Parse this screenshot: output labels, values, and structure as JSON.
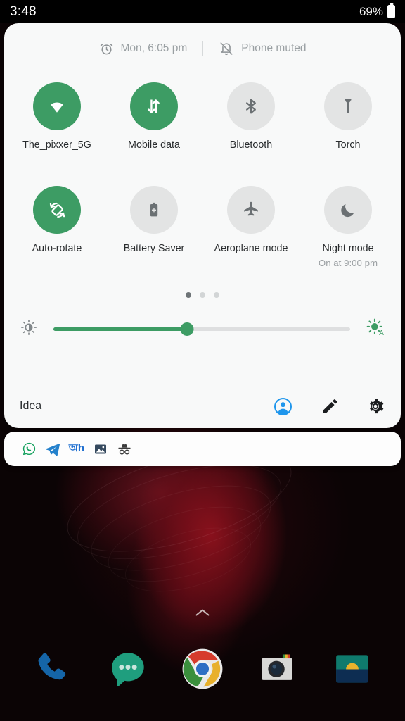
{
  "status_bar": {
    "clock": "3:48",
    "battery_percent": "69%",
    "battery_icon": "battery-icon"
  },
  "quick_settings": {
    "header": {
      "alarm_icon": "alarm-clock-icon",
      "alarm_text": "Mon, 6:05 pm",
      "mute_icon": "bell-off-icon",
      "mute_text": "Phone muted"
    },
    "tiles": [
      {
        "id": "wifi",
        "label": "The_pixxer_5G",
        "sub": "",
        "active": true,
        "icon": "wifi-icon"
      },
      {
        "id": "mobiledata",
        "label": "Mobile data",
        "sub": "",
        "active": true,
        "icon": "mobile-data-icon"
      },
      {
        "id": "bluetooth",
        "label": "Bluetooth",
        "sub": "",
        "active": false,
        "icon": "bluetooth-icon"
      },
      {
        "id": "torch",
        "label": "Torch",
        "sub": "",
        "active": false,
        "icon": "flashlight-icon"
      },
      {
        "id": "autorotate",
        "label": "Auto-rotate",
        "sub": "",
        "active": true,
        "icon": "auto-rotate-icon"
      },
      {
        "id": "batterysaver",
        "label": "Battery Saver",
        "sub": "",
        "active": false,
        "icon": "battery-saver-icon"
      },
      {
        "id": "aeroplane",
        "label": "Aeroplane mode",
        "sub": "",
        "active": false,
        "icon": "airplane-icon"
      },
      {
        "id": "nightmode",
        "label": "Night mode",
        "sub": "On at 9:00 pm",
        "active": false,
        "icon": "moon-icon"
      }
    ],
    "pager": {
      "count": 3,
      "active_index": 0
    },
    "brightness": {
      "low_icon": "brightness-low-icon",
      "auto_icon": "brightness-auto-icon",
      "value_percent": 45
    },
    "footer": {
      "carrier": "Idea",
      "actions": [
        {
          "id": "user",
          "icon": "user-avatar-icon"
        },
        {
          "id": "edit",
          "icon": "pencil-icon"
        },
        {
          "id": "settings",
          "icon": "gear-icon"
        }
      ]
    }
  },
  "notification_shelf": {
    "icons": [
      {
        "id": "whatsapp",
        "icon": "whatsapp-icon"
      },
      {
        "id": "telegram",
        "icon": "telegram-icon"
      },
      {
        "id": "script-app",
        "icon": "script-text-icon",
        "glyph": "অh"
      },
      {
        "id": "photos",
        "icon": "photo-icon"
      },
      {
        "id": "incognito",
        "icon": "incognito-icon"
      }
    ]
  },
  "home": {
    "drawer_handle_icon": "chevron-up-icon",
    "dock": [
      {
        "id": "phone",
        "icon": "phone-icon"
      },
      {
        "id": "messages",
        "icon": "messages-icon"
      },
      {
        "id": "chrome",
        "icon": "chrome-icon"
      },
      {
        "id": "camera",
        "icon": "camera-icon"
      },
      {
        "id": "gallery",
        "icon": "landscape-app-icon"
      }
    ]
  },
  "colors": {
    "accent_green": "#3d9c64",
    "panel_bg": "#f8f9f9",
    "tile_off_bg": "#e3e4e4",
    "tile_off_icon": "#6b7073",
    "label": "#292c2e",
    "sub_label": "#9ca1a4",
    "avatar_blue": "#1f96ec"
  }
}
